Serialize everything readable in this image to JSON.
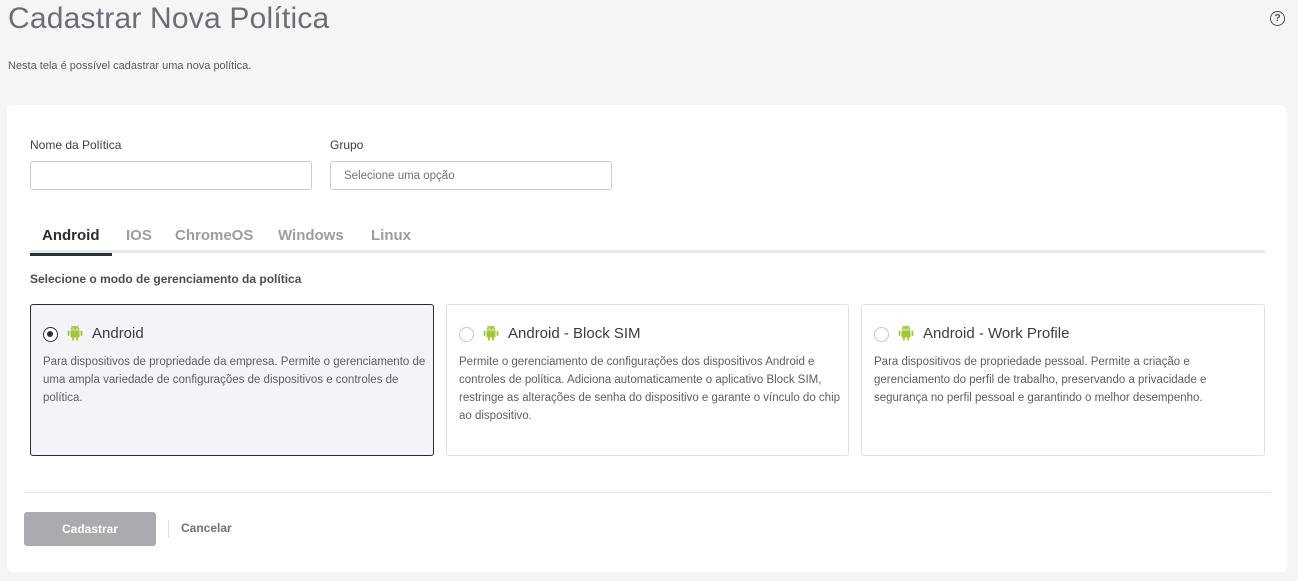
{
  "page": {
    "title": "Cadastrar Nova Política",
    "subtitle": "Nesta tela é possível cadastrar uma nova política.",
    "help_icon": "question-circle-icon"
  },
  "form": {
    "policy_name": {
      "label": "Nome da Política",
      "value": "",
      "placeholder": ""
    },
    "group": {
      "label": "Grupo",
      "placeholder": "Selecione uma opção"
    }
  },
  "tabs": [
    {
      "label": "Android",
      "active": true
    },
    {
      "label": "IOS",
      "active": false
    },
    {
      "label": "ChromeOS",
      "active": false
    },
    {
      "label": "Windows",
      "active": false
    },
    {
      "label": "Linux",
      "active": false
    }
  ],
  "management": {
    "section_label": "Selecione o modo de gerenciamento da política",
    "icon": "android-icon",
    "icon_color": "#a4c639",
    "modes": [
      {
        "title": "Android",
        "description": "Para dispositivos de propriedade da empresa. Permite o gerenciamento de uma ampla variedade de configurações de dispositivos e controles de política.",
        "selected": true
      },
      {
        "title": "Android - Block SIM",
        "description": "Permite o gerenciamento de configurações dos dispositivos Android e controles de política. Adiciona automaticamente o aplicativo Block SIM, restringe as alterações de senha do dispositivo e garante o vínculo do chip ao dispositivo.",
        "selected": false
      },
      {
        "title": "Android - Work Profile",
        "description": "Para dispositivos de propriedade pessoal. Permite a criação e gerenciamento do perfil de trabalho, preservando a privacidade e segurança no perfil pessoal e garantindo o melhor desempenho.",
        "selected": false
      }
    ]
  },
  "actions": {
    "submit_label": "Cadastrar",
    "cancel_label": "Cancelar"
  }
}
